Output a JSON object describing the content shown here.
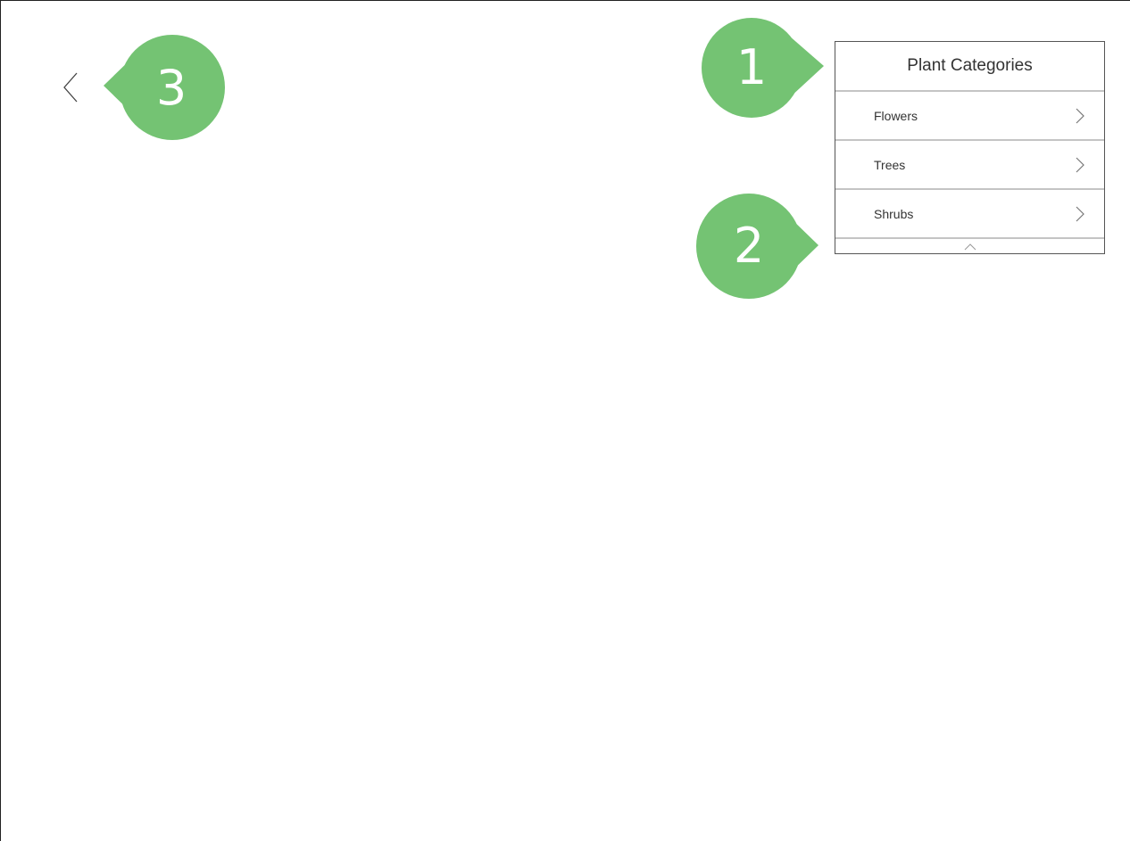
{
  "panel": {
    "title": "Plant Categories",
    "items": [
      {
        "label": "Flowers"
      },
      {
        "label": "Trees"
      },
      {
        "label": "Shrubs"
      }
    ]
  },
  "callouts": [
    {
      "number": "1"
    },
    {
      "number": "2"
    },
    {
      "number": "3"
    }
  ],
  "icons": {
    "back": "chevron-left-icon",
    "row": "chevron-right-icon",
    "scroll": "chevron-up-icon"
  },
  "colors": {
    "callout": "#74c373",
    "divider": "#c4c4c4"
  }
}
